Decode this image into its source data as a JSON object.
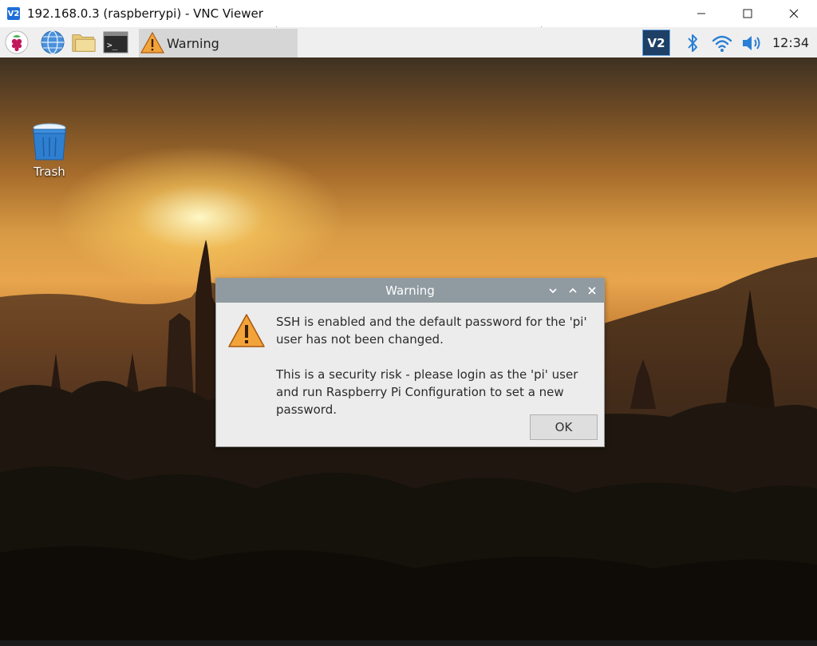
{
  "window": {
    "title": "192.168.0.3 (raspberrypi) - VNC Viewer",
    "app_icon_text": "V2",
    "minimize_glyph": "–",
    "maximize_glyph": "☐",
    "close_glyph": "✕"
  },
  "panel": {
    "launchers": [
      {
        "name": "raspberry-menu",
        "icon": "raspberry-icon"
      },
      {
        "name": "web-browser",
        "icon": "globe-icon"
      },
      {
        "name": "file-manager",
        "icon": "folder-icon"
      },
      {
        "name": "terminal",
        "icon": "terminal-icon",
        "glyph": ">_"
      }
    ],
    "taskbar_item": {
      "label": "Warning",
      "icon": "warning-icon"
    },
    "tray": {
      "vnc_icon_text": "V2",
      "bluetooth_icon": "bluetooth-icon",
      "wifi_icon": "wifi-icon",
      "volume_icon": "volume-icon",
      "clock": "12:34"
    }
  },
  "desktop": {
    "icons": [
      {
        "label": "Trash",
        "icon": "trash-icon"
      }
    ]
  },
  "dialog": {
    "title": "Warning",
    "line1": "SSH is enabled and the default password for the 'pi' user has not been changed.",
    "line2": "This is a security risk - please login as the 'pi' user and run Raspberry Pi Configuration to set a new password.",
    "ok_label": "OK",
    "icon": "warning-icon"
  },
  "colors": {
    "dialog_title_bar": "#8f9aa1",
    "panel": "#efefef",
    "vnc_tray": "#1e3f66",
    "warning": "#f2a33a"
  }
}
